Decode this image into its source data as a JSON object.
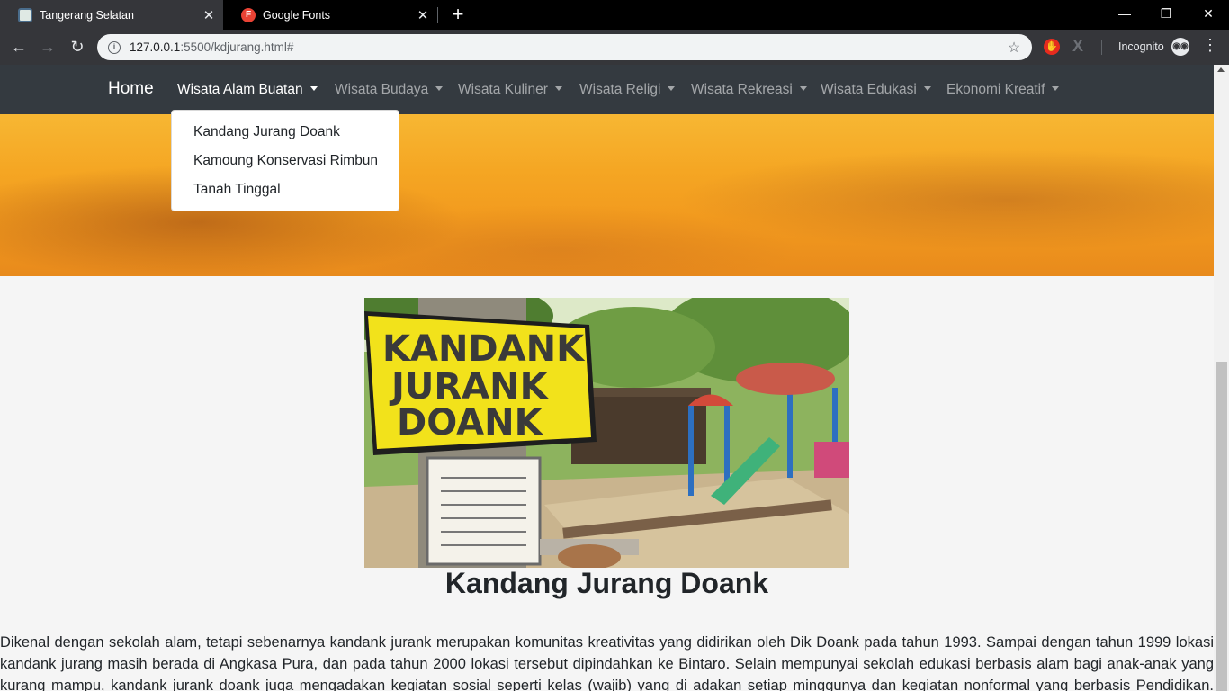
{
  "browser": {
    "tabs": [
      {
        "title": "Tangerang Selatan",
        "active": true
      },
      {
        "title": "Google Fonts",
        "active": false,
        "favicon_letter": "F"
      }
    ],
    "url_host": "127.0.0.1",
    "url_rest": ":5500/kdjurang.html#",
    "incognito_label": "Incognito"
  },
  "site": {
    "brand": "Home",
    "nav": [
      {
        "label": "Wisata Alam Buatan",
        "open": true
      },
      {
        "label": "Wisata Budaya"
      },
      {
        "label": "Wisata Kuliner"
      },
      {
        "label": "Wisata Religi"
      },
      {
        "label": "Wisata Rekreasi"
      },
      {
        "label": "Wisata Edukasi"
      },
      {
        "label": "Ekonomi Kreatif"
      }
    ],
    "dropdown": [
      "Kandang Jurang Doank",
      "Kamoung Konservasi Rimbun",
      "Tanah Tinggal"
    ]
  },
  "photo": {
    "sign_lines": [
      "KANDANK",
      "JURANK",
      "DOANK"
    ]
  },
  "content": {
    "heading": "Kandang Jurang Doank",
    "paragraph": "Dikenal dengan sekolah alam, tetapi sebenarnya kandank jurank merupakan komunitas kreativitas yang didirikan oleh Dik Doank pada tahun 1993. Sampai dengan tahun 1999 lokasi kandank jurang masih berada di Angkasa Pura, dan pada tahun 2000 lokasi tersebut dipindahkan ke Bintaro. Selain mempunyai sekolah edukasi berbasis alam bagi anak-anak yang kurang mampu, kandank jurank doank juga mengadakan kegiatan sosial seperti kelas (wajib) yang di adakan setiap minggunya dan kegiatan nonformal yang berbasis Pendidikan. Selain itu juga kandank"
  },
  "colors": {
    "navbar": "#343a40",
    "page_bg": "#f5f5f5",
    "sign_yellow": "#f2e21b"
  }
}
